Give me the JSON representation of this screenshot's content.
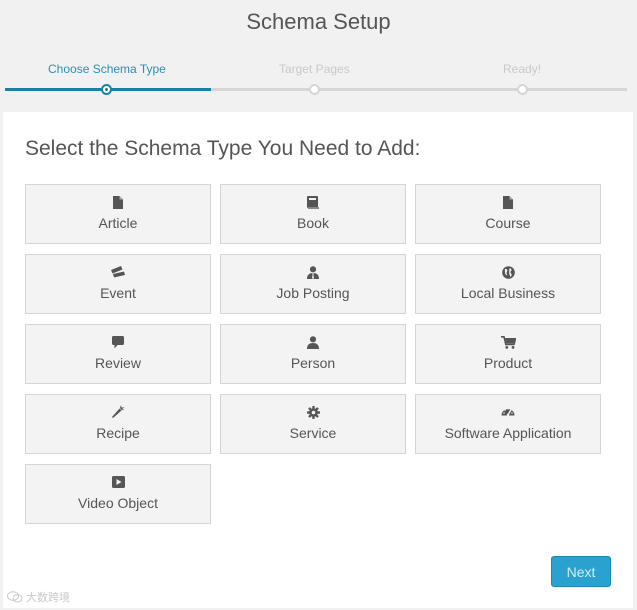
{
  "header": {
    "title": "Schema Setup"
  },
  "steps": [
    {
      "label": "Choose Schema Type",
      "state": "active"
    },
    {
      "label": "Target Pages",
      "state": "inactive"
    },
    {
      "label": "Ready!",
      "state": "inactive"
    }
  ],
  "panel": {
    "heading": "Select the Schema Type You Need to Add:",
    "tiles": [
      {
        "label": "Article",
        "icon": "document-icon"
      },
      {
        "label": "Book",
        "icon": "book-icon"
      },
      {
        "label": "Course",
        "icon": "document-icon"
      },
      {
        "label": "Event",
        "icon": "tickets-icon"
      },
      {
        "label": "Job Posting",
        "icon": "user-tie-icon"
      },
      {
        "label": "Local Business",
        "icon": "globe-icon"
      },
      {
        "label": "Review",
        "icon": "comment-icon"
      },
      {
        "label": "Person",
        "icon": "user-icon"
      },
      {
        "label": "Product",
        "icon": "cart-icon"
      },
      {
        "label": "Recipe",
        "icon": "carrot-icon"
      },
      {
        "label": "Service",
        "icon": "gear-icon"
      },
      {
        "label": "Software Application",
        "icon": "gauge-icon"
      },
      {
        "label": "Video Object",
        "icon": "play-icon"
      }
    ],
    "next_label": "Next"
  },
  "watermark": {
    "text": "大数跨境"
  },
  "colors": {
    "accent": "#1e7fa6",
    "button": "#2aa2cf",
    "tile_bg": "#f3f3f3"
  }
}
